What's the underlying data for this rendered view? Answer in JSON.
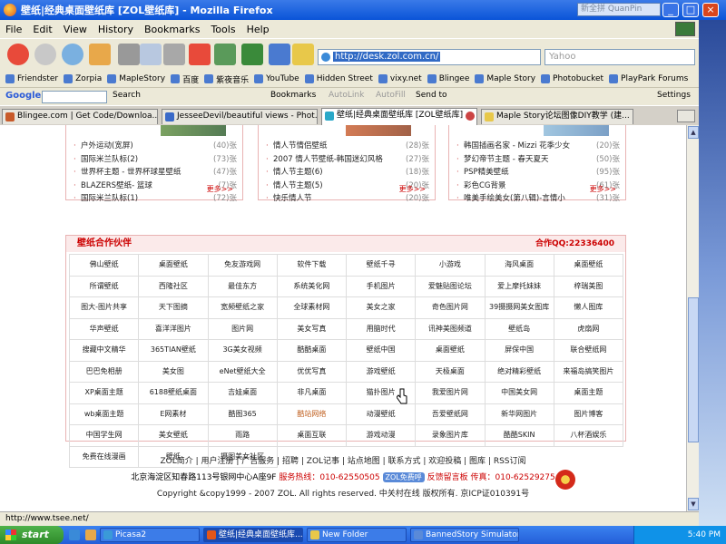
{
  "window": {
    "title": "壁纸|经典桌面壁纸库 [ZOL壁纸库] - Mozilla Firefox",
    "ime": "新全拼 QuanPin"
  },
  "menu": [
    "File",
    "Edit",
    "View",
    "History",
    "Bookmarks",
    "Tools",
    "Help"
  ],
  "nav": {
    "url": "http://desk.zol.com.cn/",
    "search_placeholder": "Yahoo"
  },
  "bookmarks": [
    "Friendster",
    "Zorpia",
    "MapleStory",
    "百度",
    "紫夜音乐",
    "YouTube",
    "Hidden Street",
    "vixy.net",
    "Blingee",
    "Maple Story",
    "Photobucket",
    "PlayPark Forums"
  ],
  "google_toolbar": {
    "logo": "Google",
    "search": "Search",
    "bookmarks": "Bookmarks",
    "autolink": "AutoLink",
    "autofill": "AutoFill",
    "sendto": "Send to",
    "settings": "Settings"
  },
  "tabs": [
    "Blingee.com | Get Code/Downloa...",
    "JesseeDevil/beautiful views - Phot...",
    "壁纸|经典桌面壁纸库 [ZOL壁纸库]",
    "Maple Story论坛图像DIY教学 (建..."
  ],
  "cards": [
    {
      "items": [
        {
          "name": "户外运动(宽屏)",
          "count": "(40)张"
        },
        {
          "name": "国际米兰队标(2)",
          "count": "(73)张"
        },
        {
          "name": "世界杯主题 - 世界杯球星壁纸",
          "count": "(47)张"
        },
        {
          "name": "BLAZERS壁纸- 篮球",
          "count": "(7)张"
        },
        {
          "name": "国际米兰队标(1)",
          "count": "(72)张"
        }
      ],
      "more": "更多>>"
    },
    {
      "items": [
        {
          "name": "情人节情侣壁纸",
          "count": "(28)张"
        },
        {
          "name": "2007 情人节壁纸-韩国迷幻风格",
          "count": "(27)张"
        },
        {
          "name": "情人节主题(6)",
          "count": "(18)张"
        },
        {
          "name": "情人节主题(5)",
          "count": "(20)张"
        },
        {
          "name": "快乐情人节",
          "count": "(20)张"
        }
      ],
      "more": "更多>>"
    },
    {
      "items": [
        {
          "name": "韩国插画名家 - Mizzi 花季少女",
          "count": "(20)张"
        },
        {
          "name": "梦幻帝节主题 - 春天夏天",
          "count": "(50)张"
        },
        {
          "name": "PSP精美壁纸",
          "count": "(95)张"
        },
        {
          "name": "彩色CG背景",
          "count": "(61)张"
        },
        {
          "name": "唯美手绘美女(第八辑)-言情小",
          "count": "(31)张"
        }
      ],
      "more": "更多>>"
    }
  ],
  "partners": {
    "title": "壁纸合作伙伴",
    "qq": "合作QQ:22336400",
    "cells": [
      "佛山壁纸",
      "桌面壁纸",
      "免友游戏网",
      "软件下载",
      "壁纸千寻",
      "小游戏",
      "海风桌面",
      "桌面壁纸",
      "所谓壁纸",
      "西隆社区",
      "最佳东方",
      "系统美化网",
      "手机图片",
      "爱魅贴图论坛",
      "爱上摩托妹妹",
      "梓瑞美图",
      "图大-图片共享",
      "天下图摘",
      "宽频壁纸之家",
      "全球素材网",
      "美女之家",
      "奇色图片网",
      "39摄摄网美女图库",
      "懒人图库",
      "华声壁纸",
      "喜洋洋图片",
      "图片网",
      "美女写真",
      "用脑时代",
      "讯神美图频道",
      "壁纸岛",
      "虎扇网",
      "搜藏中文精华",
      "365TIAN壁纸",
      "3G美女视频",
      "酷酷桌面",
      "壁纸中国",
      "桌面壁纸",
      "屏保中国",
      "联合壁纸网",
      "巴巴免相册",
      "美女图",
      "eNet壁纸大全",
      "优优写真",
      "游戏壁纸",
      "天极桌面",
      "绝对精彩壁纸",
      "来福岛搞笑图片",
      "XP桌面主题",
      "6188壁纸桌面",
      "吉娃桌面",
      "非凡桌面",
      "猫扑图片",
      "我爱图片网",
      "中国美女网",
      "桌面主题",
      "wb桌面主题",
      "E网素材",
      "酷图365",
      "酷站网络",
      "动漫壁纸",
      "吾爱壁纸网",
      "新华网图片",
      "图片博客",
      "中国学生网",
      "美女壁纸",
      "雨路",
      "桌面互联",
      "游戏动漫",
      "录象图片库",
      "酷酷SKIN",
      "八杯酒娱乐",
      "免费在线漫画",
      "壁纸",
      "摄图美女社区"
    ]
  },
  "footer": {
    "links": "ZOL简介 | 用户注册 | 广告服务 | 招聘 | ZOL记事 | 站点地图 | 联系方式 | 欢迎投稿 | 图库 | RSS订阅",
    "address": "北京海淀区知春路113号银网中心A座9F",
    "hotline": "服务热线：010-62550505",
    "badge": "ZOL免费呼",
    "feedback": "反馈留言板",
    "fax": "传真：010-62529275",
    "copyright": "Copyright &copy1999 - 2007 ZOL. All rights reserved. 中关村在线 版权所有. 京ICP证010391号"
  },
  "status": "http://www.tsee.net/",
  "taskbar": {
    "start": "start",
    "items": [
      "Picasa2",
      "壁纸|经典桌面壁纸库...",
      "New Folder",
      "BannedStory Simulator"
    ],
    "time": "5:40 PM"
  }
}
